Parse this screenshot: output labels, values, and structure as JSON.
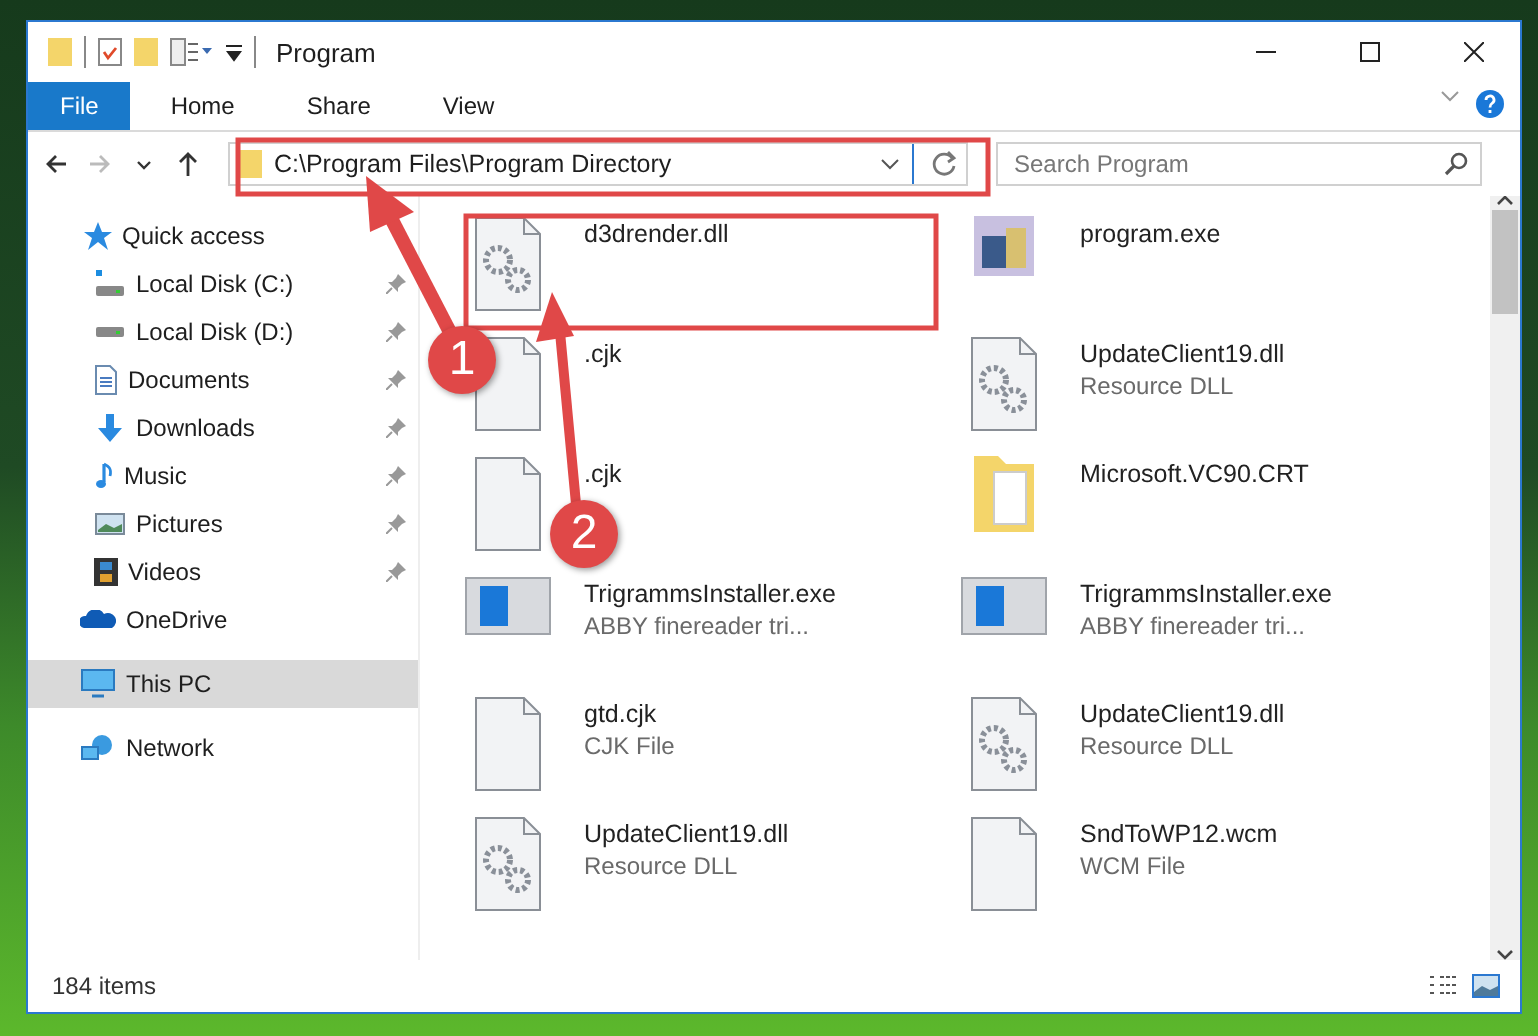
{
  "window": {
    "title": "Program"
  },
  "ribbon": {
    "tabs": [
      {
        "label": "File",
        "selected": true
      },
      {
        "label": "Home",
        "selected": false
      },
      {
        "label": "Share",
        "selected": false
      },
      {
        "label": "View",
        "selected": false
      }
    ]
  },
  "navigation": [
    {
      "kind": "back",
      "disabled": false
    },
    {
      "kind": "forward",
      "disabled": true
    },
    {
      "kind": "recent",
      "disabled": false
    },
    {
      "kind": "up",
      "disabled": false
    }
  ],
  "address_bar": {
    "path": "C:\\Program Files\\Program Directory"
  },
  "search": {
    "placeholder": "Search Program"
  },
  "sidebar": {
    "items": [
      {
        "label": "Quick access",
        "kind": "star",
        "selected": false,
        "children": [
          {
            "label": "Local Disk (C:)",
            "kind": "drive-c",
            "pinned": true,
            "selected": false
          },
          {
            "label": "Local Disk (D:)",
            "kind": "drive",
            "pinned": true,
            "selected": false
          },
          {
            "label": "Documents",
            "kind": "documents",
            "pinned": true,
            "selected": false
          },
          {
            "label": "Downloads",
            "kind": "downloads",
            "pinned": true,
            "selected": false
          },
          {
            "label": "Music",
            "kind": "music",
            "pinned": true,
            "selected": false
          },
          {
            "label": "Pictures",
            "kind": "pictures",
            "pinned": true,
            "selected": false
          },
          {
            "label": "Videos",
            "kind": "videos",
            "pinned": true,
            "selected": false
          }
        ]
      },
      {
        "label": "OneDrive",
        "kind": "cloud",
        "selected": false
      },
      {
        "label": "This PC",
        "kind": "pc",
        "selected": true
      },
      {
        "label": "Network",
        "kind": "network",
        "selected": false
      }
    ]
  },
  "files": [
    {
      "name": "d3drender.dll",
      "kind": "dll"
    },
    {
      "name": "program.exe",
      "kind": "exe"
    },
    {
      "name": ".cjk",
      "kind": "file"
    },
    {
      "name": "UpdateClient19.dll",
      "type": "Resource DLL",
      "kind": "dll"
    },
    {
      "name": ".cjk",
      "kind": "file"
    },
    {
      "name": "Microsoft.VC90.CRT",
      "kind": "folder"
    },
    {
      "name": "TrigrammsInstaller.exe",
      "type": "ABBY finereader tri...",
      "kind": "installer"
    },
    {
      "name": "TrigrammsInstaller.exe",
      "type": "ABBY finereader tri...",
      "kind": "installer"
    },
    {
      "name": "gtd.cjk",
      "type": "CJK File",
      "kind": "file"
    },
    {
      "name": "UpdateClient19.dll",
      "type": "Resource DLL",
      "kind": "dll"
    },
    {
      "name": "UpdateClient19.dll",
      "type": "Resource DLL",
      "kind": "dll"
    },
    {
      "name": "SndToWP12.wcm",
      "type": "WCM File",
      "kind": "file"
    }
  ],
  "status_bar": {
    "item_count": "184 items"
  },
  "annotations": {
    "steps": [
      {
        "number": "1"
      },
      {
        "number": "2"
      }
    ]
  }
}
